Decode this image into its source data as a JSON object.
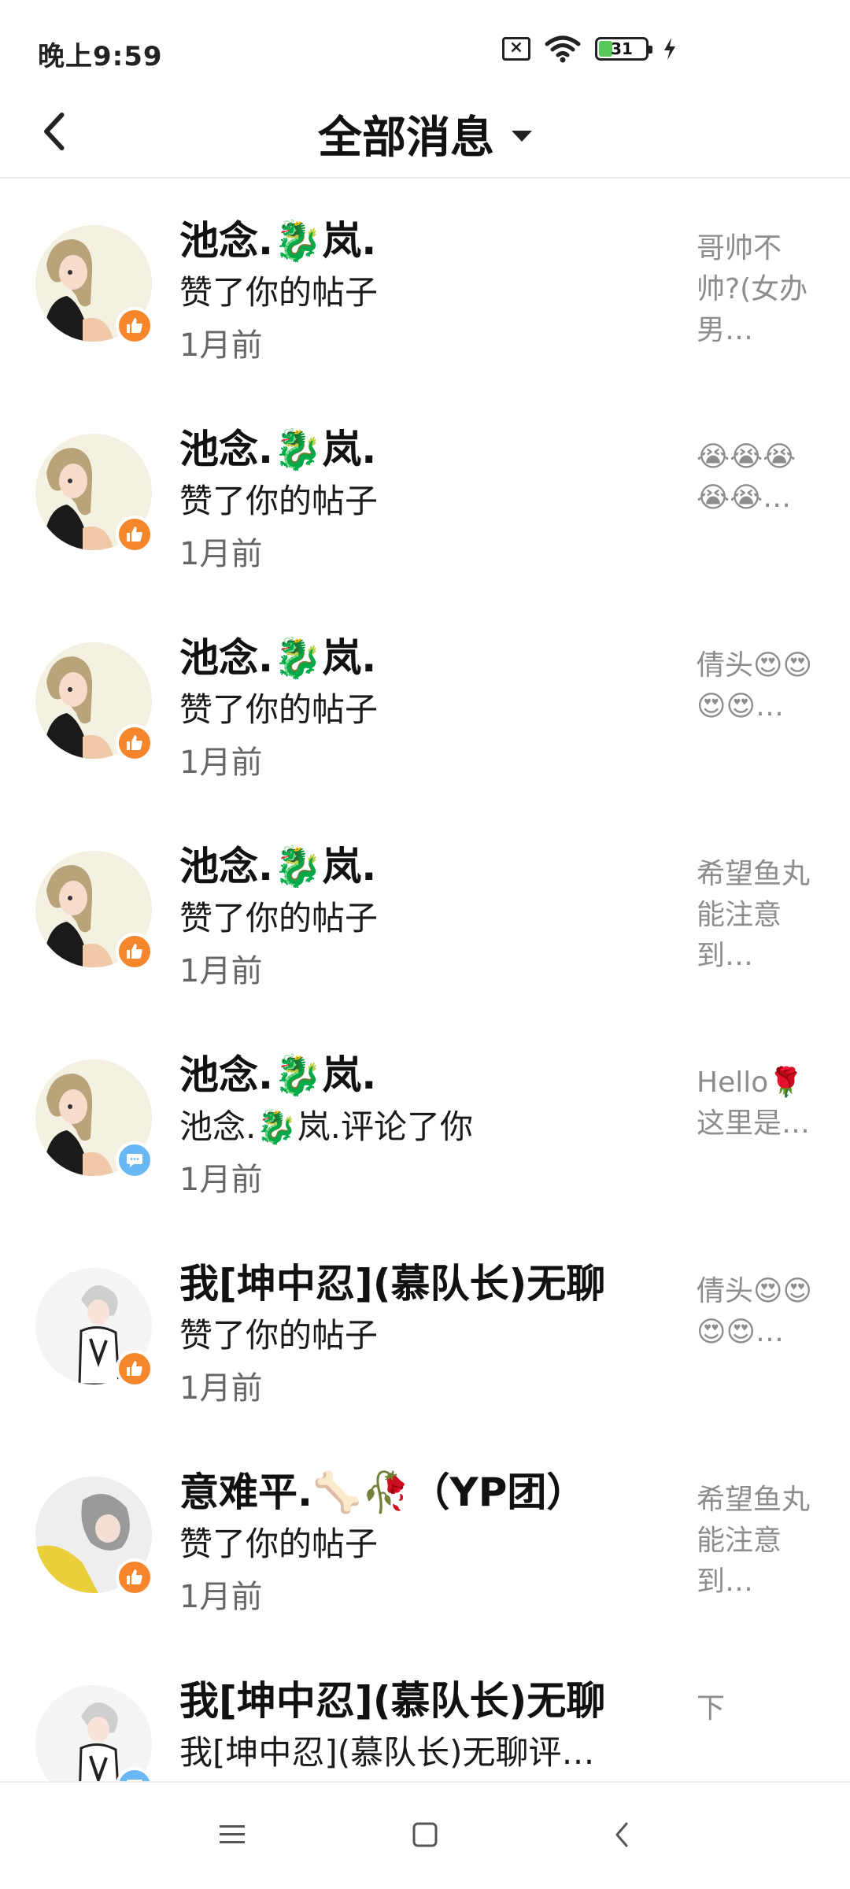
{
  "status_bar": {
    "time": "晚上9:59",
    "battery": "31"
  },
  "header": {
    "title": "全部消息",
    "back_icon": "back-arrow-icon",
    "dropdown_icon": "dropdown-triangle-icon"
  },
  "messages": [
    {
      "name": "池念.🐉岚.",
      "action": "赞了你的帖子",
      "time": "1月前",
      "preview": "哥帅不帅?(女办男…",
      "badge": "like",
      "avatar": "girl-avatar"
    },
    {
      "name": "池念.🐉岚.",
      "action": "赞了你的帖子",
      "time": "1月前",
      "preview": "😭😭😭😭😭…",
      "badge": "like",
      "avatar": "girl-avatar"
    },
    {
      "name": "池念.🐉岚.",
      "action": "赞了你的帖子",
      "time": "1月前",
      "preview": "倩头😍😍😍😍…",
      "badge": "like",
      "avatar": "girl-avatar"
    },
    {
      "name": "池念.🐉岚.",
      "action": "赞了你的帖子",
      "time": "1月前",
      "preview": "希望鱼丸能注意到…",
      "badge": "like",
      "avatar": "girl-avatar"
    },
    {
      "name": "池念.🐉岚.",
      "action": "池念.🐉岚.评论了你",
      "time": "1月前",
      "preview": "Hello🌹这里是…",
      "badge": "comment",
      "avatar": "girl-avatar"
    },
    {
      "name": "我[坤中忍](慕队长)无聊",
      "action": "赞了你的帖子",
      "time": "1月前",
      "preview": "倩头😍😍😍😍…",
      "badge": "like",
      "avatar": "white-hair-avatar"
    },
    {
      "name": "意难平.🦴🥀（YP团）",
      "action": "赞了你的帖子",
      "time": "1月前",
      "preview": "希望鱼丸能注意到…",
      "badge": "like",
      "avatar": "gray-hair-avatar"
    },
    {
      "name": "我[坤中忍](慕队长)无聊",
      "action": "我[坤中忍](慕队长)无聊评…",
      "time": "",
      "preview": "下",
      "badge": "comment",
      "avatar": "white-hair-avatar"
    }
  ],
  "colors": {
    "like_badge": "#f5862b",
    "comment_badge": "#69b7f5",
    "preview_text": "#8d8d8d"
  },
  "nav_bar": {
    "menu_icon": "menu-icon",
    "home_icon": "home-square-icon",
    "back_icon": "back-triangle-icon"
  }
}
